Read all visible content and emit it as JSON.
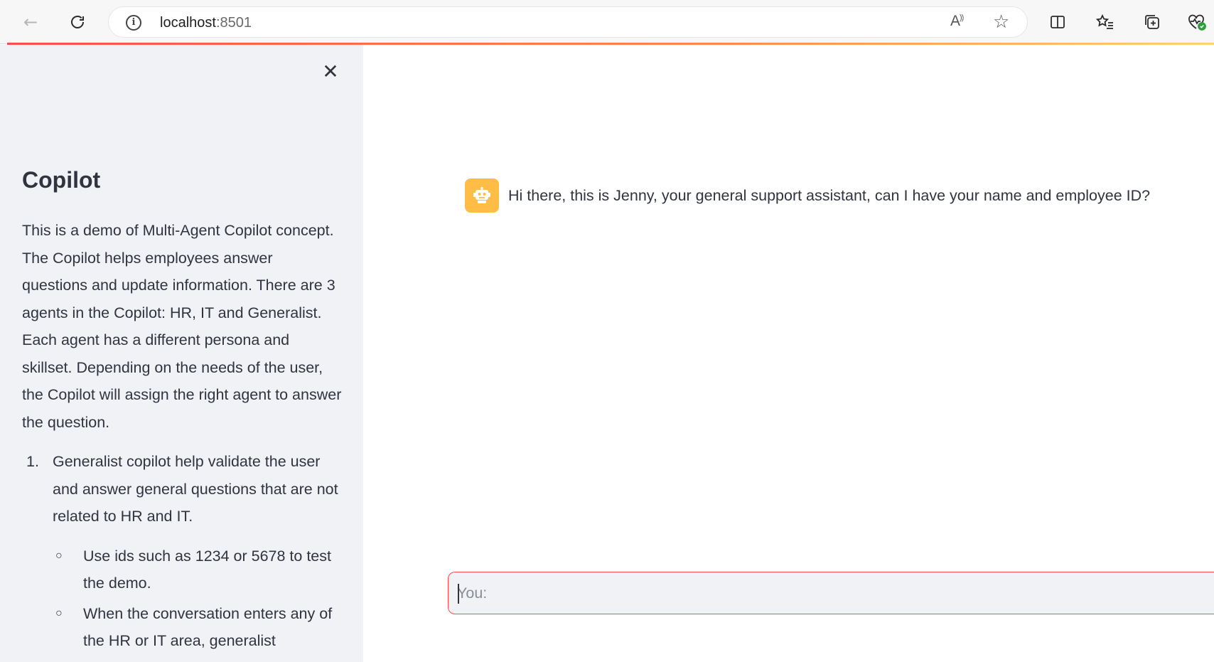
{
  "browser": {
    "url_host": "localhost",
    "url_port": ":8501"
  },
  "sidebar": {
    "title": "Copilot",
    "description": "This is a demo of Multi-Agent Copilot concept. The Copilot helps employees answer questions and update information. There are 3 agents in the Copilot: HR, IT and Generalist. Each agent has a different persona and skillset. Depending on the needs of the user, the Copilot will assign the right agent to answer the question.",
    "list": [
      {
        "number": "1.",
        "text": "Generalist copilot help validate the user and answer general questions that are not related to HR and IT.",
        "subitems": [
          "Use ids such as 1234 or 5678 to test the demo.",
          "When the conversation enters any of the HR or IT area, generalist"
        ]
      }
    ]
  },
  "chat": {
    "messages": [
      {
        "role": "assistant",
        "text": "Hi there, this is Jenny, your general support assistant, can I have your name and employee ID?"
      }
    ],
    "input_placeholder": "You:"
  },
  "colors": {
    "accent": "#ff4b4b",
    "avatar_bg": "#ffbd45",
    "sidebar_bg": "#f0f2f6"
  }
}
